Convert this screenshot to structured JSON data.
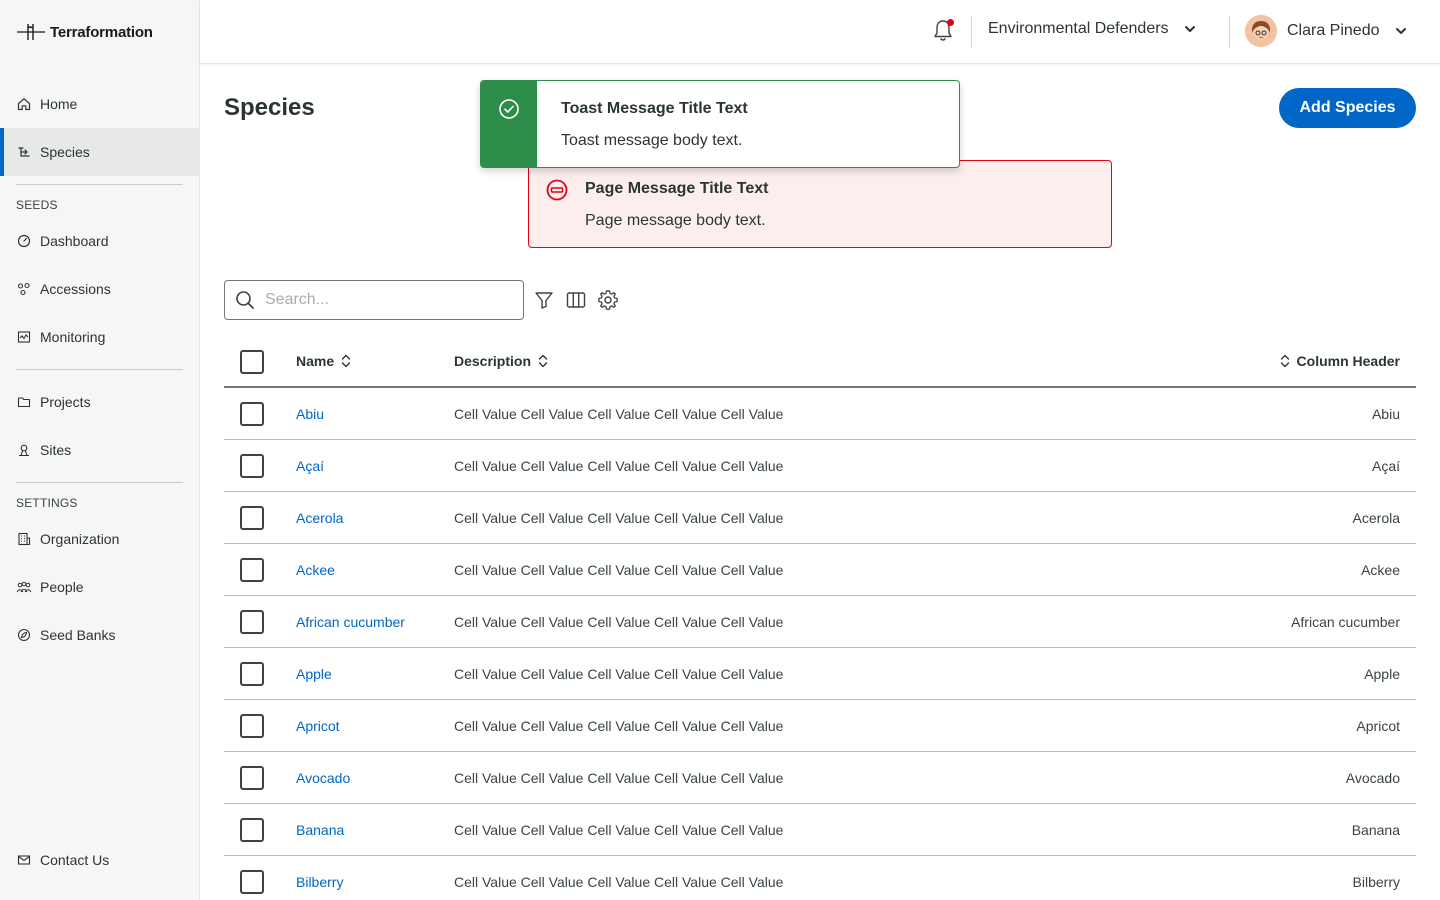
{
  "app": {
    "name": "Terraformation"
  },
  "sidebar": {
    "items_top": [
      {
        "label": "Home",
        "icon": "home-icon"
      },
      {
        "label": "Species",
        "icon": "species-icon",
        "active": true
      }
    ],
    "section_seeds": "SEEDS",
    "items_seeds": [
      {
        "label": "Dashboard",
        "icon": "dashboard-icon"
      },
      {
        "label": "Accessions",
        "icon": "accessions-icon"
      },
      {
        "label": "Monitoring",
        "icon": "monitoring-icon"
      }
    ],
    "items_mid": [
      {
        "label": "Projects",
        "icon": "folder-icon"
      },
      {
        "label": "Sites",
        "icon": "sites-icon"
      }
    ],
    "section_settings": "SETTINGS",
    "items_settings": [
      {
        "label": "Organization",
        "icon": "organization-icon"
      },
      {
        "label": "People",
        "icon": "people-icon"
      },
      {
        "label": "Seed Banks",
        "icon": "seed-bank-icon"
      }
    ],
    "contact": {
      "label": "Contact Us",
      "icon": "mail-icon"
    }
  },
  "topbar": {
    "organization": "Environmental Defenders",
    "user": "Clara Pinedo",
    "notification_unread": true
  },
  "page": {
    "title": "Species",
    "add_button": "Add Species"
  },
  "toast": {
    "title": "Toast Message Title Text",
    "body": "Toast message body text.",
    "color": "#2d8c4a"
  },
  "page_message": {
    "title": "Page Message Title Text",
    "body": "Page message body text.",
    "color": "#e2001a"
  },
  "search": {
    "placeholder": "Search..."
  },
  "table": {
    "headers": {
      "name": "Name",
      "description": "Description",
      "column": "Column Header"
    },
    "rows": [
      {
        "name": "Abiu",
        "description": "Cell Value Cell Value Cell Value Cell Value Cell Value",
        "column": "Abiu"
      },
      {
        "name": "Açaí",
        "description": "Cell Value Cell Value Cell Value Cell Value Cell Value",
        "column": "Açaí"
      },
      {
        "name": "Acerola",
        "description": "Cell Value Cell Value Cell Value Cell Value Cell Value",
        "column": "Acerola"
      },
      {
        "name": "Ackee",
        "description": "Cell Value Cell Value Cell Value Cell Value Cell Value",
        "column": "Ackee"
      },
      {
        "name": "African cucumber",
        "description": "Cell Value Cell Value Cell Value Cell Value Cell Value",
        "column": "African cucumber"
      },
      {
        "name": "Apple",
        "description": "Cell Value Cell Value Cell Value Cell Value Cell Value",
        "column": "Apple"
      },
      {
        "name": "Apricot",
        "description": "Cell Value Cell Value Cell Value Cell Value Cell Value",
        "column": "Apricot"
      },
      {
        "name": "Avocado",
        "description": "Cell Value Cell Value Cell Value Cell Value Cell Value",
        "column": "Avocado"
      },
      {
        "name": "Banana",
        "description": "Cell Value Cell Value Cell Value Cell Value Cell Value",
        "column": "Banana"
      },
      {
        "name": "Bilberry",
        "description": "Cell Value Cell Value Cell Value Cell Value Cell Value",
        "column": "Bilberry"
      }
    ]
  }
}
